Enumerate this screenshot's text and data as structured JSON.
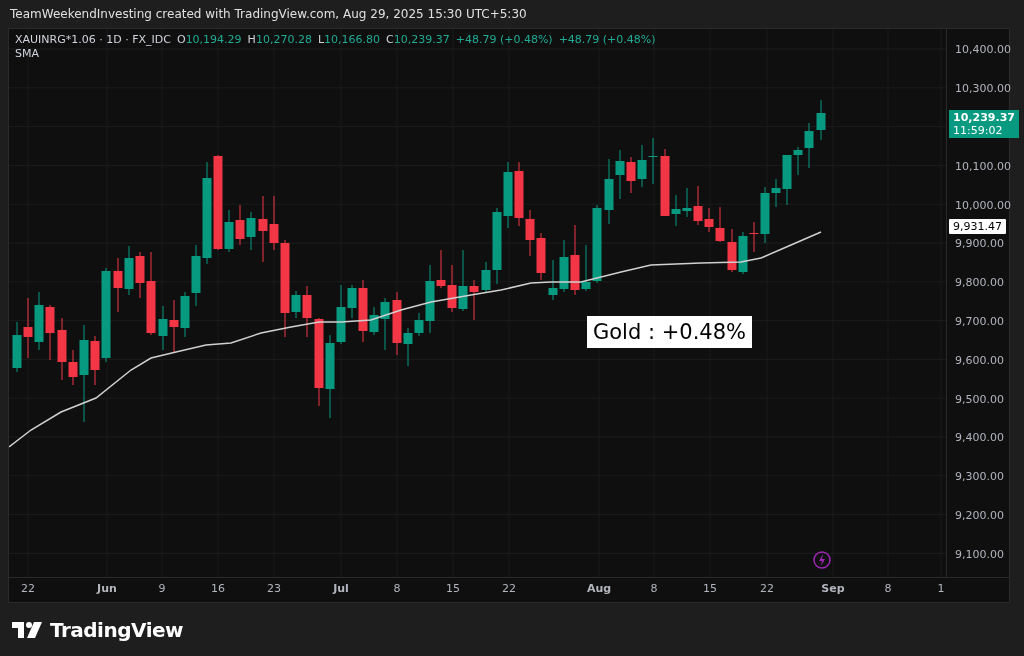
{
  "header": {
    "text": "TeamWeekendInvesting created with TradingView.com, Aug 29, 2025 15:30 UTC+5:30"
  },
  "legend": {
    "symbol": "XAUINRG*1.06 · 1D · FX_IDC",
    "ohlc": [
      {
        "label": "O",
        "value": "10,194.29"
      },
      {
        "label": "H",
        "value": "10,270.28"
      },
      {
        "label": "L",
        "value": "10,166.80"
      },
      {
        "label": "C",
        "value": "10,239.37"
      }
    ],
    "changes": [
      "+48.79 (+0.48%)",
      "+48.79 (+0.48%)"
    ],
    "indicator": "SMA"
  },
  "price_axis": {
    "items": [
      {
        "kind": "tick",
        "text": "10,400.00"
      },
      {
        "kind": "tick",
        "text": "10,300.00"
      },
      {
        "kind": "last_price",
        "price": "10,239.37",
        "countdown": "11:59:02"
      },
      {
        "kind": "tick",
        "text": "10,100.00"
      },
      {
        "kind": "tick",
        "text": "10,000.00"
      },
      {
        "kind": "tick",
        "text": "9,900.00"
      },
      {
        "kind": "tick",
        "text": "9,800.00"
      },
      {
        "kind": "tick",
        "text": "9,700.00"
      },
      {
        "kind": "tick",
        "text": "9,600.00"
      },
      {
        "kind": "tick",
        "text": "9,500.00"
      },
      {
        "kind": "tick",
        "text": "9,400.00"
      },
      {
        "kind": "tick",
        "text": "9,300.00"
      },
      {
        "kind": "tick",
        "text": "9,200.00"
      },
      {
        "kind": "tick",
        "text": "9,100.00"
      }
    ]
  },
  "sma_tag": {
    "value": "9,931.47"
  },
  "annotation": {
    "text": "Gold : +0.48%"
  },
  "time_axis": {
    "labels": [
      {
        "text": "22",
        "bold": false
      },
      {
        "text": "Jun",
        "bold": true
      },
      {
        "text": "9",
        "bold": false
      },
      {
        "text": "16",
        "bold": false
      },
      {
        "text": "23",
        "bold": false
      },
      {
        "text": "Jul",
        "bold": true
      },
      {
        "text": "8",
        "bold": false
      },
      {
        "text": "15",
        "bold": false
      },
      {
        "text": "22",
        "bold": false
      },
      {
        "text": "Aug",
        "bold": true
      },
      {
        "text": "8",
        "bold": false
      },
      {
        "text": "15",
        "bold": false
      },
      {
        "text": "22",
        "bold": false
      },
      {
        "text": "Sep",
        "bold": true
      },
      {
        "text": "8",
        "bold": false
      },
      {
        "text": "1",
        "bold": false
      }
    ]
  },
  "footer": {
    "brand": "TradingView"
  }
}
